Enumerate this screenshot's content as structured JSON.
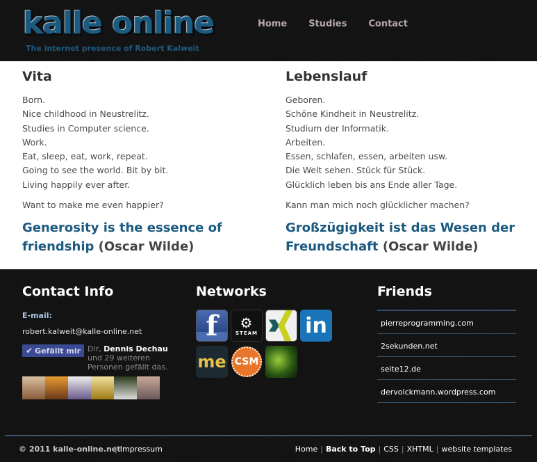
{
  "header": {
    "logo": "kalle online",
    "tagline": "The internet presence of Robert Kalweit",
    "nav": [
      {
        "label": "Home"
      },
      {
        "label": "Studies"
      },
      {
        "label": "Contact"
      }
    ]
  },
  "main": {
    "left": {
      "title": "Vita",
      "lines": [
        "Born.",
        "Nice childhood in Neustrelitz.",
        "Studies in Computer science.",
        "Work.",
        "Eat, sleep, eat, work, repeat.",
        "Going to see the world. Bit by bit.",
        "Living happily ever after."
      ],
      "ask": "Want to make me even happier?",
      "quote_link": "Generosity is the essence of friendship",
      "quote_author": "(Oscar Wilde)"
    },
    "right": {
      "title": "Lebenslauf",
      "lines": [
        "Geboren.",
        "Schöne Kindheit in Neustrelitz.",
        "Studium der Informatik.",
        "Arbeiten.",
        "Essen, schlafen, essen, arbeiten usw.",
        "Die Welt sehen. Stück für Stück.",
        "Glücklich leben bis ans Ende aller Tage."
      ],
      "ask": "Kann man mich noch glücklicher machen?",
      "quote_link": "Großzügigkeit ist das Wesen der Freundschaft",
      "quote_author": "(Oscar Wilde)"
    }
  },
  "contact": {
    "title": "Contact Info",
    "email_label": "E-mail:",
    "email": "robert.kalweit@kalle-online.net",
    "like_button": "Gefällt mir",
    "like_prefix": "Dir,",
    "like_name": "Dennis Dechau",
    "like_suffix": "und 29 weiteren Personen gefällt das.",
    "faces": [
      {
        "name": "friend-photo-1",
        "color": "#c9a07a"
      },
      {
        "name": "friend-photo-2",
        "color": "#d88a2a"
      },
      {
        "name": "friend-photo-3",
        "color": "#7a6a9a"
      },
      {
        "name": "friend-photo-4",
        "color": "#c8a020"
      },
      {
        "name": "friend-photo-5",
        "color": "#3a4a2a"
      },
      {
        "name": "friend-photo-6",
        "color": "#9a7a6a"
      }
    ]
  },
  "networks": {
    "title": "Networks",
    "items": [
      {
        "name": "facebook",
        "glyph": "f"
      },
      {
        "name": "steam",
        "glyph": "STEAM"
      },
      {
        "name": "xing",
        "glyph": ""
      },
      {
        "name": "linkedin",
        "glyph": "in"
      },
      {
        "name": "me",
        "glyph": "me"
      },
      {
        "name": "csm",
        "glyph": "CSM"
      },
      {
        "name": "game-avatar",
        "glyph": ""
      }
    ]
  },
  "friends": {
    "title": "Friends",
    "links": [
      "pierreprogramming.com",
      "2sekunden.net",
      "seite12.de",
      "dervolckmann.wordpress.com"
    ]
  },
  "footer": {
    "copyright": "© 2011 kalle-online.net",
    "impressum": "Impressum",
    "links": [
      "Home",
      "Back to Top",
      "CSS",
      "XHTML",
      "website templates"
    ]
  }
}
